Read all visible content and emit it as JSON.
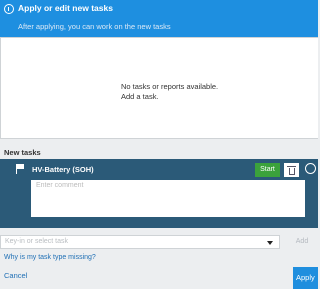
{
  "header": {
    "title": "Apply or edit new tasks",
    "subtitle": "After applying, you can work on the new tasks",
    "icon": "info-icon"
  },
  "empty_state": {
    "line1": "No tasks or reports available.",
    "line2": "Add a task."
  },
  "new_tasks": {
    "label": "New tasks",
    "items": [
      {
        "name": "HV-Battery (SOH)",
        "start_label": "Start",
        "comment_placeholder": "Enter comment",
        "icons": [
          "flag-icon",
          "trash-icon",
          "more-icon"
        ]
      }
    ]
  },
  "task_select": {
    "placeholder": "Key-in or select task"
  },
  "add_label": "Add",
  "missing_link": "Why is my task type missing?",
  "footer": {
    "cancel_label": "Cancel",
    "apply_label": "Apply"
  },
  "colors": {
    "header_bg": "#1e8fe0",
    "task_card_bg": "#2b5a78",
    "start_green": "#3ba23b",
    "link_blue": "#1f6fb5"
  }
}
